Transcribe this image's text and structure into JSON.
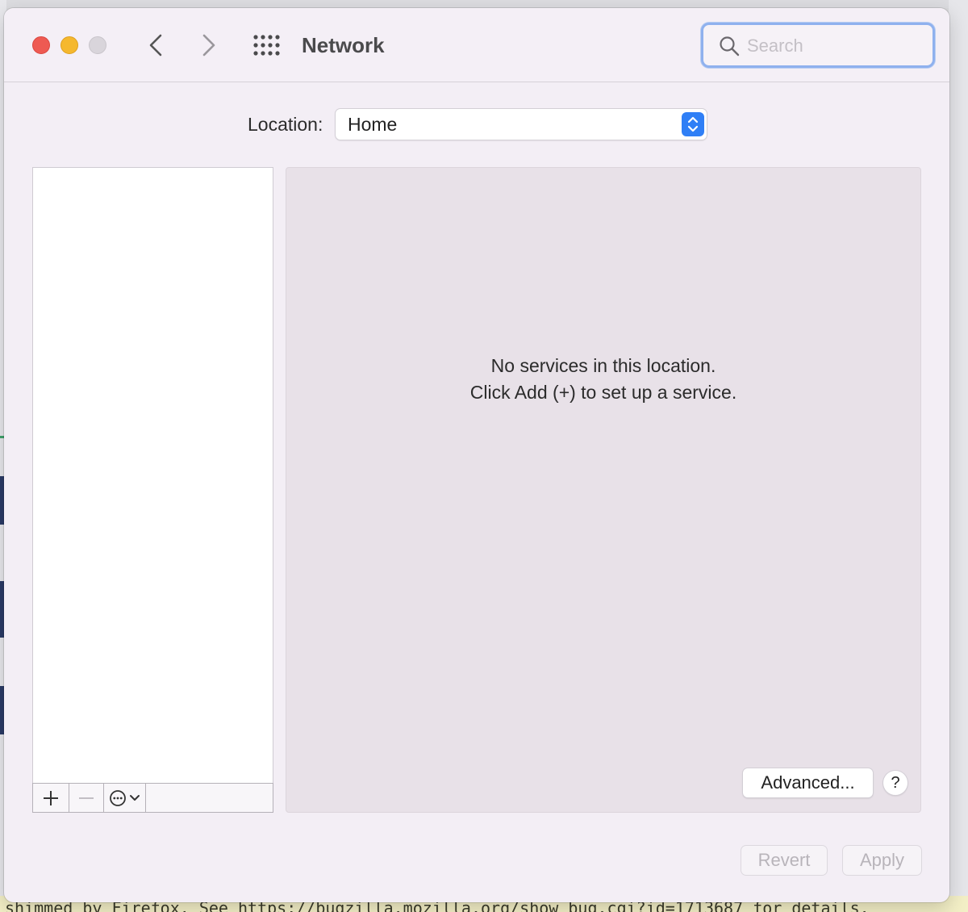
{
  "window": {
    "title": "Network",
    "search": {
      "placeholder": "Search",
      "value": ""
    }
  },
  "location": {
    "label": "Location:",
    "selected": "Home"
  },
  "services": {
    "items": [],
    "empty_line1": "No services in this location.",
    "empty_line2": "Click Add (+) to set up a service."
  },
  "buttons": {
    "advanced": "Advanced...",
    "help": "?",
    "revert": "Revert",
    "apply": "Apply"
  },
  "background_text": "shimmed by Firefox. See https://bugzilla.mozilla.org/show_bug.cgi?id=1713687 for details.",
  "colors": {
    "close": "#ee5a52",
    "minimize": "#f5b82e",
    "maximize_disabled": "#d9d5db",
    "accent": "#2f7ff6",
    "search_focus": "#8fb1ee"
  }
}
